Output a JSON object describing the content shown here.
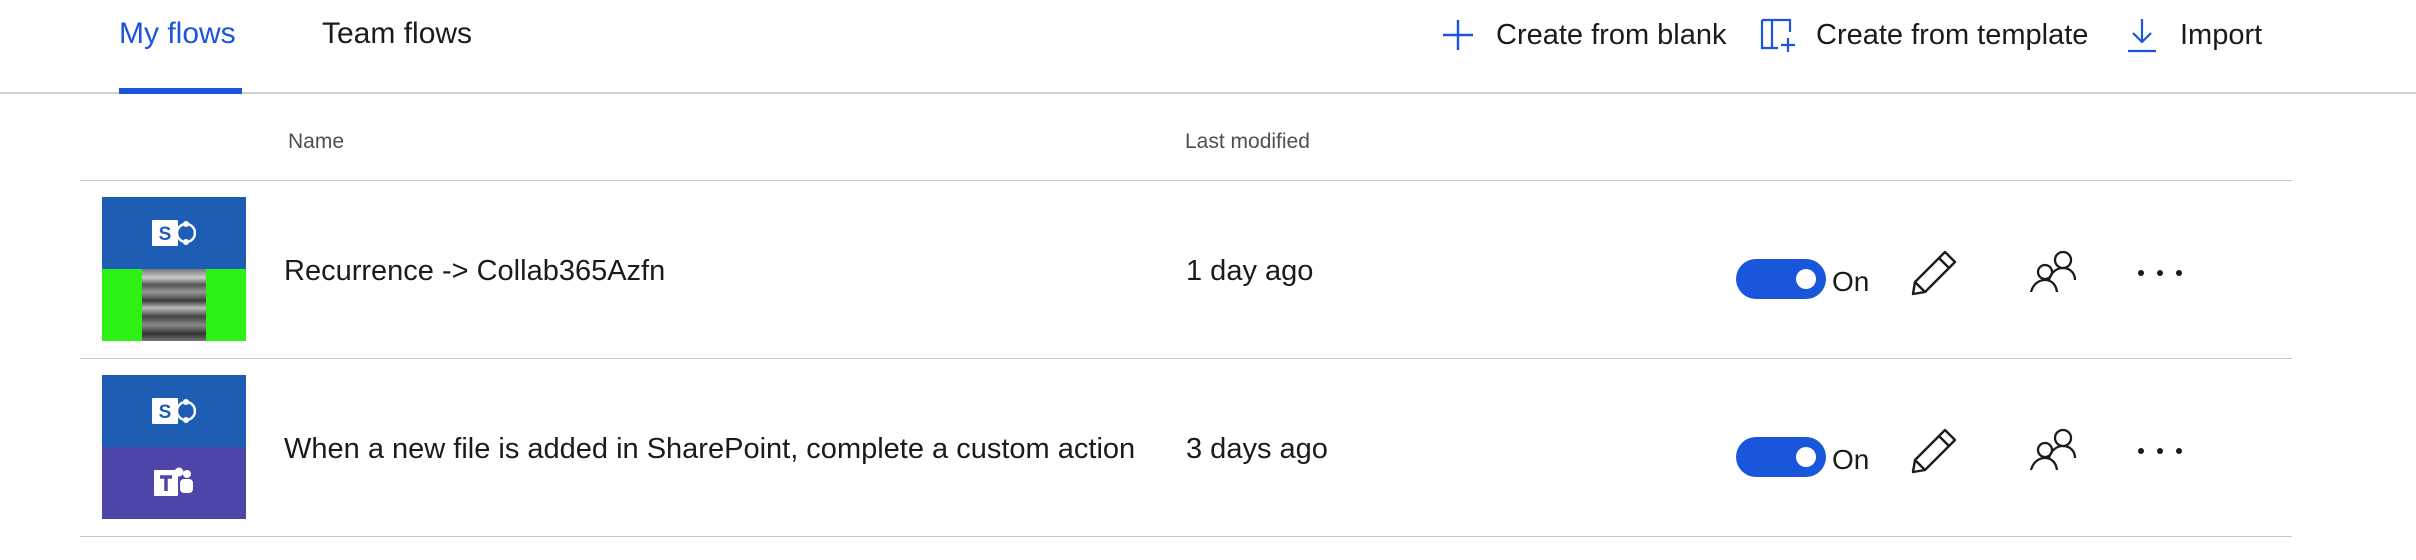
{
  "tabs": [
    {
      "label": "My flows",
      "active": true
    },
    {
      "label": "Team flows",
      "active": false
    }
  ],
  "commands": {
    "create_blank": {
      "label": "Create from blank",
      "icon": "plus-icon"
    },
    "create_template": {
      "label": "Create from template",
      "icon": "template-icon"
    },
    "import": {
      "label": "Import",
      "icon": "download-icon"
    }
  },
  "columns": {
    "name": "Name",
    "last_modified": "Last modified"
  },
  "accent_color": "#1a56db",
  "flows": [
    {
      "name": "Recurrence -> Collab365Azfn",
      "last_modified": "1 day ago",
      "status": "On",
      "enabled": true,
      "icons": [
        "sharepoint-icon",
        "recurrence-image"
      ]
    },
    {
      "name": "When a new file is added in SharePoint, complete a custom action",
      "last_modified": "3 days ago",
      "status": "On",
      "enabled": true,
      "icons": [
        "sharepoint-icon",
        "teams-icon"
      ]
    }
  ]
}
